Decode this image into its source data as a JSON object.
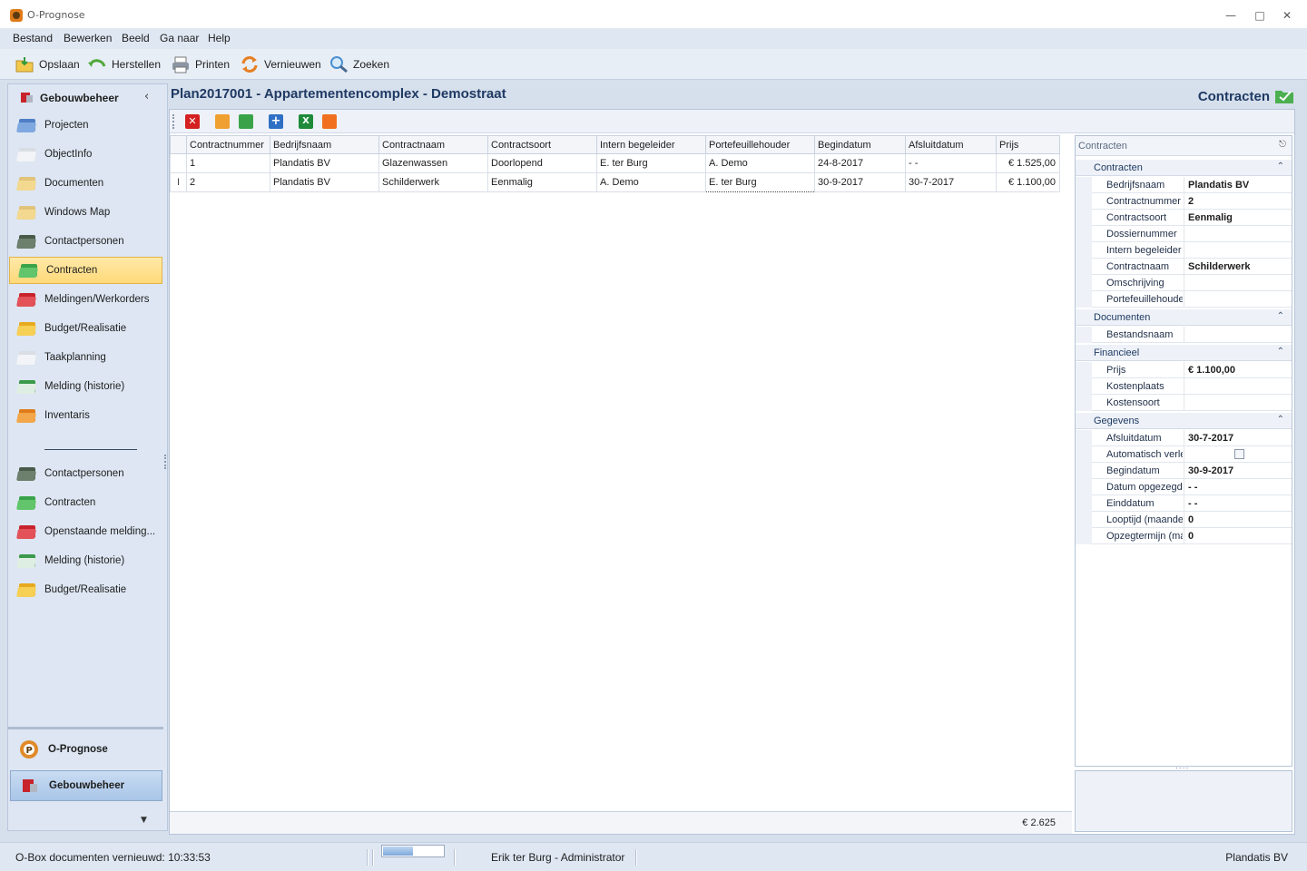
{
  "window": {
    "title": "O-Prognose"
  },
  "menu": [
    "Bestand",
    "Bewerken",
    "Beeld",
    "Ga naar",
    "Help"
  ],
  "toolbar": {
    "save": "Opslaan",
    "restore": "Herstellen",
    "print": "Printen",
    "refresh": "Vernieuwen",
    "search": "Zoeken"
  },
  "sidebar": {
    "header": "Gebouwbeheer",
    "items": [
      {
        "label": "Projecten",
        "icon": "folder-blue-icon"
      },
      {
        "label": "ObjectInfo",
        "icon": "house-icon"
      },
      {
        "label": "Documenten",
        "icon": "folder-icon"
      },
      {
        "label": "Windows Map",
        "icon": "folder-icon"
      },
      {
        "label": "Contactpersonen",
        "icon": "folder-dark-icon"
      },
      {
        "label": "Contracten",
        "icon": "folder-green-icon"
      },
      {
        "label": "Meldingen/Werkorders",
        "icon": "folder-red-icon"
      },
      {
        "label": "Budget/Realisatie",
        "icon": "folder-yellow-icon"
      },
      {
        "label": "Taakplanning",
        "icon": "calendar-icon"
      },
      {
        "label": "Melding (historie)",
        "icon": "clock-icon"
      },
      {
        "label": "Inventaris",
        "icon": "folder-orange-icon"
      }
    ],
    "favorites": [
      {
        "label": "Contactpersonen"
      },
      {
        "label": "Contracten"
      },
      {
        "label": "Openstaande melding..."
      },
      {
        "label": "Melding (historie)"
      },
      {
        "label": "Budget/Realisatie"
      }
    ],
    "bottom_tabs": [
      "O-Prognose",
      "Gebouwbeheer"
    ]
  },
  "main": {
    "title": "Plan2017001 - Appartementencomplex - Demostraat",
    "page_tag": "Contracten"
  },
  "grid": {
    "columns": [
      "Contractnummer",
      "Bedrijfsnaam",
      "Contractnaam",
      "Contractsoort",
      "Intern begeleider",
      "Portefeuillehouder",
      "Begindatum",
      "Afsluitdatum",
      "Prijs"
    ],
    "rows": [
      [
        "1",
        "Plandatis BV",
        "Glazenwassen",
        "Doorlopend",
        "E. ter Burg",
        "A. Demo",
        "24-8-2017",
        " -  -",
        "€ 1.525,00"
      ],
      [
        "2",
        "Plandatis BV",
        "Schilderwerk",
        "Eenmalig",
        "A. Demo",
        "E. ter Burg",
        "30-9-2017",
        "30-7-2017",
        "€ 1.100,00"
      ]
    ],
    "row_indicator": "I",
    "total": "€ 2.625"
  },
  "properties": {
    "title": "Contracten",
    "categories": [
      {
        "name": "Contracten",
        "rows": [
          {
            "key": "Bedrijfsnaam",
            "value": "Plandatis BV"
          },
          {
            "key": "Contractnummer",
            "value": "2"
          },
          {
            "key": "Contractsoort",
            "value": "Eenmalig"
          },
          {
            "key": "Dossiernummer",
            "value": ""
          },
          {
            "key": "Intern begeleider",
            "value": ""
          },
          {
            "key": "Contractnaam",
            "value": "Schilderwerk"
          },
          {
            "key": "Omschrijving",
            "value": ""
          },
          {
            "key": "Portefeuillehouder",
            "value": ""
          }
        ]
      },
      {
        "name": "Documenten",
        "rows": [
          {
            "key": "Bestandsnaam",
            "value": ""
          }
        ]
      },
      {
        "name": "Financieel",
        "rows": [
          {
            "key": "Prijs",
            "value": "€ 1.100,00"
          },
          {
            "key": "Kostenplaats",
            "value": ""
          },
          {
            "key": "Kostensoort",
            "value": ""
          }
        ]
      },
      {
        "name": "Gegevens",
        "rows": [
          {
            "key": "Afsluitdatum",
            "value": "30-7-2017"
          },
          {
            "key": "Automatisch verlengen",
            "value": "",
            "checkbox": true
          },
          {
            "key": "Begindatum",
            "value": "30-9-2017"
          },
          {
            "key": "Datum opgezegd",
            "value": " -  -"
          },
          {
            "key": "Einddatum",
            "value": " -  -"
          },
          {
            "key": "Looptijd (maanden)",
            "value": "0"
          },
          {
            "key": "Opzegtermijn (maanden)",
            "value": "0"
          }
        ]
      }
    ]
  },
  "status": {
    "left": "O-Box documenten vernieuwd: 10:33:53",
    "progress": 0.5,
    "user": "Erik ter Burg - Administrator",
    "company": "Plandatis BV"
  },
  "colors": {
    "accent": "#1f3a63",
    "active_nav": "#ffd97a",
    "delete": "#d42020",
    "excel": "#1f8a3a"
  }
}
